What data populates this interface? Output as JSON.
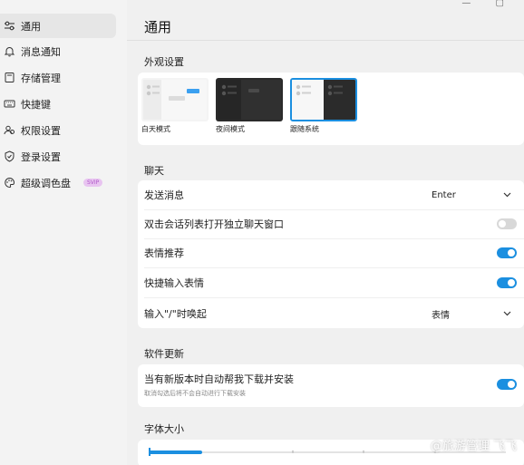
{
  "sidebar": {
    "items": [
      {
        "label": "通用",
        "icon": "sliders-icon",
        "active": true
      },
      {
        "label": "消息通知",
        "icon": "bell-icon"
      },
      {
        "label": "存储管理",
        "icon": "storage-icon"
      },
      {
        "label": "快捷键",
        "icon": "keyboard-icon"
      },
      {
        "label": "权限设置",
        "icon": "users-icon"
      },
      {
        "label": "登录设置",
        "icon": "shield-icon"
      },
      {
        "label": "超级调色盘",
        "icon": "palette-icon",
        "badge": "SVIP"
      }
    ]
  },
  "header": {
    "title": "通用",
    "window_controls": "— ▢"
  },
  "appearance": {
    "section_title": "外观设置",
    "themes": [
      {
        "label": "白天模式",
        "icon": "light-theme-icon",
        "selected": false
      },
      {
        "label": "夜间模式",
        "icon": "dark-theme-icon",
        "selected": false
      },
      {
        "label": "跟随系统",
        "icon": "system-theme-icon",
        "selected": true
      }
    ]
  },
  "chat": {
    "section_title": "聊天",
    "send_message": {
      "label": "发送消息",
      "value": "Enter"
    },
    "double_click": {
      "label": "双击会话列表打开独立聊天窗口",
      "enabled": false
    },
    "emoji_recommend": {
      "label": "表情推荐",
      "enabled": true
    },
    "shortcut_emoji": {
      "label": "快捷输入表情",
      "enabled": true
    },
    "slash_trigger": {
      "label": "输入\"/\"时唤起",
      "value": "表情"
    }
  },
  "update": {
    "section_title": "软件更新",
    "auto_update": {
      "label": "当有新版本时自动帮我下载并安装",
      "hint": "取消勾选后将不会自动进行下载安装",
      "enabled": true
    }
  },
  "font_size": {
    "section_title": "字体大小",
    "level": 0.15
  },
  "watermark": "@旅游管理 飞飞",
  "colors": {
    "accent": "#1b8fe0",
    "toggle_off": "#d8d8d8",
    "badge_bg": "#e8c4f0",
    "badge_text": "#b057c9"
  }
}
